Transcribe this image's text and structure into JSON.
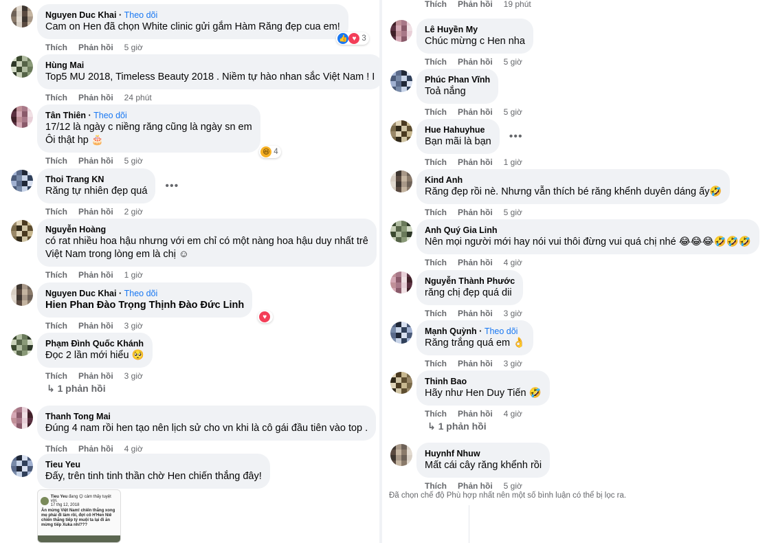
{
  "actions": {
    "like": "Thích",
    "reply": "Phản hồi"
  },
  "follow": "Theo dõi",
  "left": [
    {
      "author": "Nguyen Duc Khai",
      "follow": true,
      "lines": [
        "Cam on Hen đã chọn White clinic gửi gắm Hàm Răng đẹp cua em!"
      ],
      "time": "5 giờ",
      "reactions": {
        "types": [
          "like",
          "love"
        ],
        "count": "3"
      }
    },
    {
      "author": "Hùng Mai",
      "lines": [
        "Top5 MU 2018, Timeless Beauty 2018 . Niềm tự hào nhan sắc Việt Nam ! I"
      ],
      "time": "24 phút"
    },
    {
      "author": "Tân Thiên",
      "follow": true,
      "lines": [
        "17/12 là ngày c niềng răng cũng là ngày sn em",
        "Ôi thật hp 🎂"
      ],
      "time": "5 giờ",
      "reactions": {
        "types": [
          "haha"
        ],
        "count": "4"
      }
    },
    {
      "author": "Thoi Trang KN",
      "lines": [
        "Răng tự nhiên đẹp quá"
      ],
      "time": "2 giờ",
      "dots": true
    },
    {
      "author": "Nguyễn Hoàng",
      "lines": [
        "có rat nhiều hoa hậu nhưng với em chỉ có một nàng hoa hậu duy nhất trê",
        "Việt Nam trong lòng em là chị ☺"
      ],
      "time": "1 giờ"
    },
    {
      "author": "Nguyen Duc Khai",
      "follow": true,
      "lines": [
        "Hien Phan Đào Trọng Thịnh Đào Đức Linh"
      ],
      "bold": true,
      "time": "3 giờ",
      "reactions": {
        "types": [
          "love"
        ],
        "count": ""
      }
    },
    {
      "author": "Phạm Đình Quốc Khánh",
      "lines": [
        "Đọc 2 lần mới hiểu 🥺"
      ],
      "time": "3 giờ"
    },
    {
      "author": "Thanh Tong Mai",
      "lines": [
        "Đúng 4 nam rồi hen tạo nên lịch sử cho vn khi là cô gái đầu tiên vào top ."
      ],
      "time": "4 giờ"
    },
    {
      "author": "Tieu Yeu",
      "lines": [
        "Đấy, trên tinh tinh thần chờ Hen chiến thắng đây!"
      ],
      "time": ""
    }
  ],
  "left_replies": "↳ 1 phản hồi",
  "right_top_partial": {
    "time": "19 phút"
  },
  "right": [
    {
      "author": "Lê Huyền My",
      "lines": [
        "Chúc mừng c Hen nha"
      ],
      "time": "5 giờ"
    },
    {
      "author": "Phúc Phan Vĩnh",
      "lines": [
        "Toả nắng"
      ],
      "time": "5 giờ"
    },
    {
      "author": "Hue Hahuyhue",
      "lines": [
        "Bạn mãi là bạn"
      ],
      "time": "1 giờ",
      "dots": true
    },
    {
      "author": "Kind Anh",
      "lines": [
        "Răng đẹp rồi nè. Nhưng vẫn thích bé răng khểnh duyên dáng ấy🤣"
      ],
      "time": "5 giờ"
    },
    {
      "author": "Anh Quý Gia Linh",
      "lines": [
        "Nên mọi người mới hay nói vui thôi đừng vui quá chị nhé 😂😂😂🤣🤣🤣"
      ],
      "time": "4 giờ"
    },
    {
      "author": "Nguyễn Thành Phước",
      "lines": [
        "răng chị đẹp quá dii"
      ],
      "time": "3 giờ"
    },
    {
      "author": "Mạnh Quỳnh",
      "follow": true,
      "lines": [
        "Răng trắng quá em 👌"
      ],
      "time": "3 giờ"
    },
    {
      "author": "Thinh Bao",
      "lines": [
        "Hãy như Hen Duy Tiến 🤣"
      ],
      "time": "4 giờ"
    },
    {
      "author": "Huynhf Nhuw",
      "lines": [
        "Mất cái cây răng khểnh rồi"
      ],
      "time": "5 giờ"
    }
  ],
  "right_replies": "↳ 1 phản hồi",
  "filter_note": "Đã chọn chế độ Phù hợp nhất nên một số bình luận có thể bị lọc ra.",
  "embedded_shot": {
    "author": "Tieu Yeu",
    "status": "đang 😊 cảm thấy tuyệt vời.",
    "date": "17 thg 12, 2018",
    "post": "Ăn mừng Việt Nam! chiến thắng xong mẹ phải đi làm rồi, đợi cô H'Hen Niê chiến thắng tiếp tý muội ta lại đi ăn mừng tiếp Xuka nhỉ???"
  }
}
